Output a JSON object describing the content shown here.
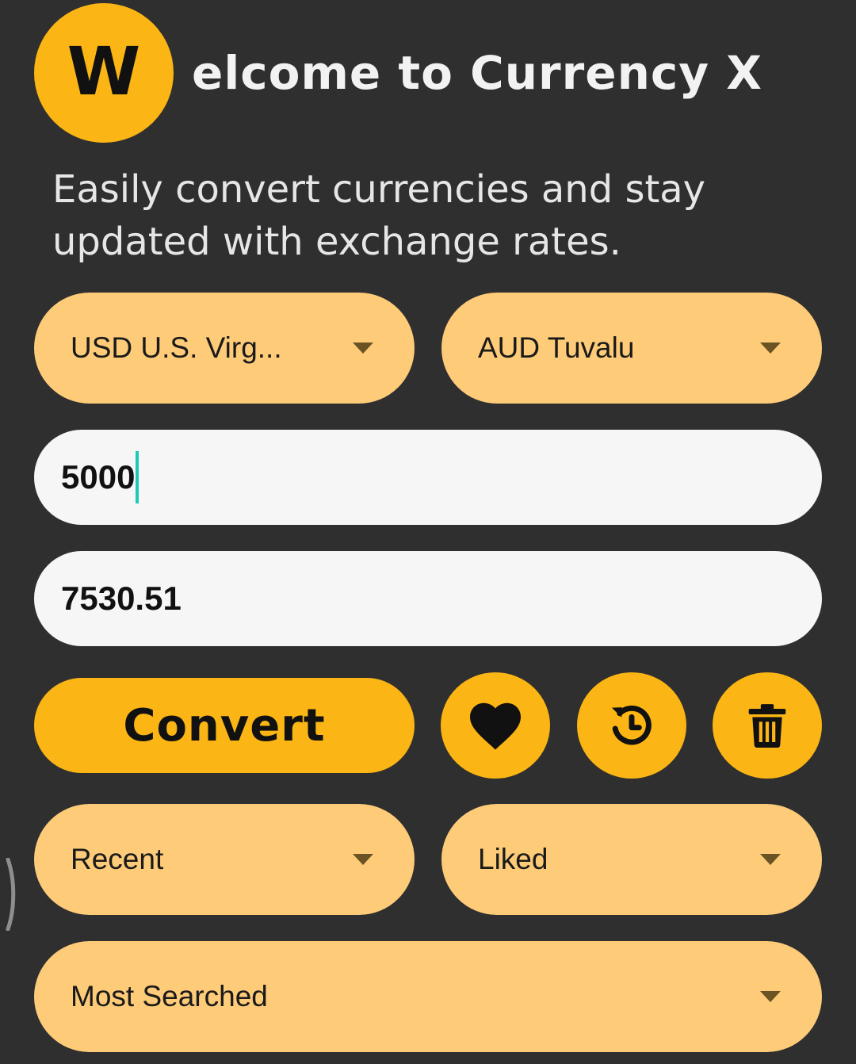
{
  "header": {
    "logo_letter": "W",
    "title": "elcome to Currency X",
    "subtitle": "Easily convert currencies and stay updated with exchange rates."
  },
  "converter": {
    "from_currency": "USD U.S. Virg...",
    "to_currency": "AUD Tuvalu",
    "amount_input": "5000",
    "result_value": "7530.51",
    "convert_label": "Convert"
  },
  "actions": {
    "like_icon": "heart-icon",
    "history_icon": "history-icon",
    "delete_icon": "trash-icon"
  },
  "lists": {
    "recent_label": "Recent",
    "liked_label": "Liked",
    "most_searched_label": "Most Searched"
  },
  "colors": {
    "background": "#2f2f2f",
    "accent": "#fbb514",
    "dropdown_fill": "#fecb78",
    "field_fill": "#f6f6f6",
    "cursor": "#1ec9b8"
  }
}
